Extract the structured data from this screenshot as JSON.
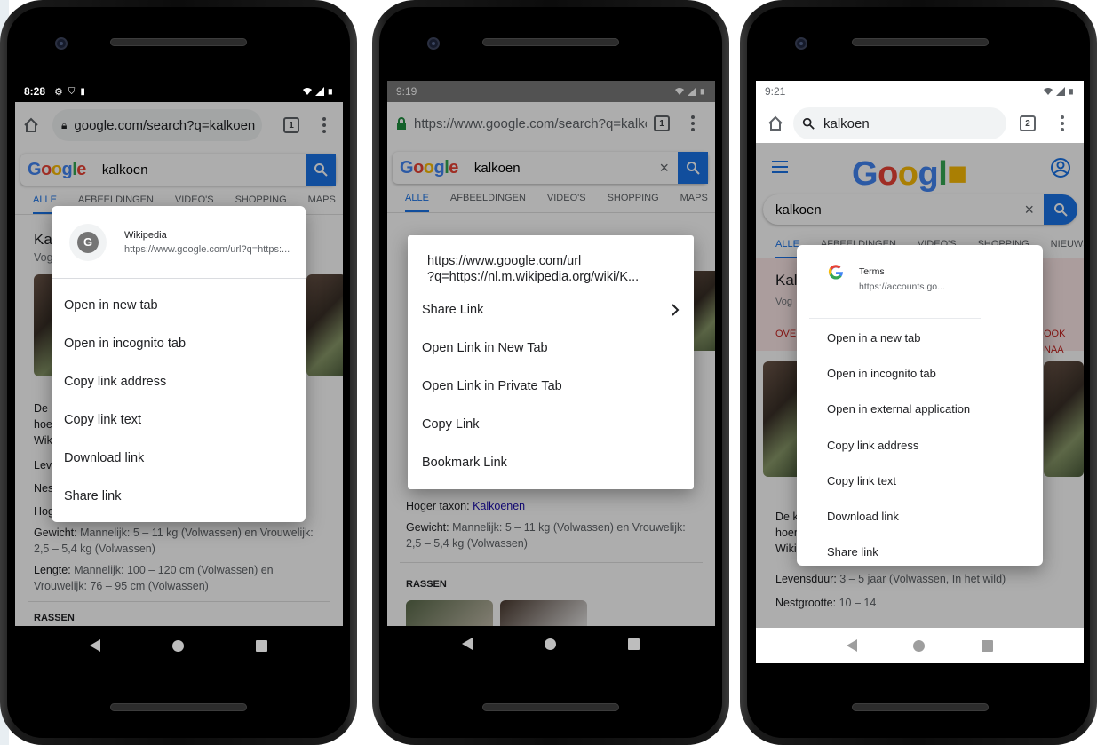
{
  "phones": [
    {
      "status": {
        "time": "8:28"
      },
      "url": "google.com/search?q=kalkoen",
      "tabs_count": "1",
      "search": {
        "query": "kalkoen"
      },
      "google_tabs": [
        "ALLE",
        "AFBEELDINGEN",
        "VIDEO'S",
        "SHOPPING",
        "MAPS"
      ],
      "kp": {
        "frag1": "Kal",
        "frag2": "Vog",
        "frag3": "De",
        "frag4": "hoe",
        "frag5": "Wik",
        "frag6": "Lev",
        "frag7": "Nes",
        "frag8": "Hog",
        "weight_label": "Gewicht:",
        "weight_value": "Mannelijk: 5 – 11 kg (Volwassen) en Vrouwelijk: 2,5 – 5,4 kg (Volwassen)",
        "length_label": "Lengte:",
        "length_value": "Mannelijk: 100 – 120 cm (Volwassen) en Vrouwelijk: 76 – 95 cm (Volwassen)",
        "rassen": "RASSEN"
      },
      "menu": {
        "avatar_letter": "G",
        "title": "Wikipedia",
        "subtitle": "https://www.google.com/url?q=https:...",
        "items": [
          "Open in new tab",
          "Open in incognito tab",
          "Copy link address",
          "Copy link text",
          "Download link",
          "Share link"
        ]
      }
    },
    {
      "status": {
        "time": "9:19"
      },
      "url": "https://www.google.com/search?q=kalko",
      "tabs_count": "1",
      "search": {
        "query": "kalkoen",
        "clear": "×"
      },
      "google_tabs": [
        "ALLE",
        "AFBEELDINGEN",
        "VIDEO'S",
        "SHOPPING",
        "MAPS"
      ],
      "kp": {
        "taxon_label": "Hoger taxon:",
        "taxon_value": "Kalkoenen",
        "weight_label": "Gewicht:",
        "weight_value": "Mannelijk: 5 – 11 kg (Volwassen) en Vrouwelijk: 2,5 – 5,4 kg (Volwassen)",
        "rassen": "RASSEN"
      },
      "menu": {
        "url_line1": "https://www.google.com/url",
        "url_line2": "?q=https://nl.m.wikipedia.org/wiki/K...",
        "items": [
          "Share Link",
          "Open Link in New Tab",
          "Open Link in Private Tab",
          "Copy Link",
          "Bookmark Link"
        ]
      }
    },
    {
      "status": {
        "time": "9:21"
      },
      "url": "kalkoen",
      "tabs_count": "2",
      "search": {
        "query": "kalkoen",
        "clear": "×"
      },
      "google_tabs": [
        "ALLE",
        "AFBEELDINGEN",
        "VIDEO'S",
        "SHOPPING",
        "NIEUWS"
      ],
      "kp": {
        "frag1": "Kal",
        "frag2": "Vog",
        "frag3": "OVE",
        "frag4": "OOK NAA",
        "frag5": "De k",
        "frag6": "hoen",
        "frag7": "Wiki",
        "life_label": "Levensduur:",
        "life_value": "3 – 5 jaar (Volwassen, In het wild)",
        "nest_label": "Nestgrootte:",
        "nest_value": "10 – 14"
      },
      "menu": {
        "title": "Terms",
        "subtitle": "https://accounts.go...",
        "items": [
          "Open in a new tab",
          "Open in incognito tab",
          "Open in external application",
          "Copy link address",
          "Copy link text",
          "Download link",
          "Share link"
        ]
      }
    }
  ],
  "colors": {
    "accent": "#1a73e8",
    "link": "#1a0dab",
    "lock_green": "#1e8e3e"
  }
}
